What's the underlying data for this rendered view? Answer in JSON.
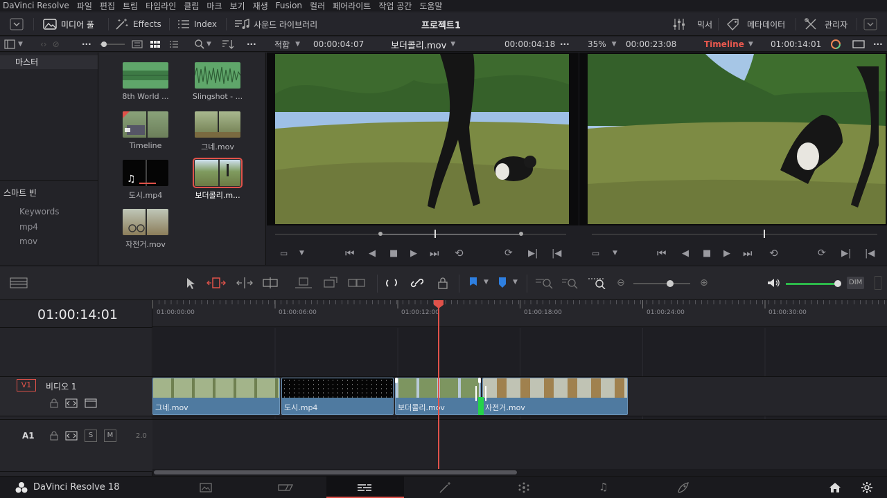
{
  "menu": [
    "DaVinci Resolve",
    "파일",
    "편집",
    "트림",
    "타임라인",
    "클립",
    "마크",
    "보기",
    "재생",
    "Fusion",
    "컬러",
    "페어라이트",
    "작업 공간",
    "도움말"
  ],
  "toolbar": {
    "media_pool": "미디어 풀",
    "effects": "Effects",
    "index": "Index",
    "sound_library": "사운드 라이브러리",
    "project_title": "프로젝트1",
    "mixer": "믹서",
    "metadata": "메타데이터",
    "inspector": "관리자"
  },
  "viewer_bar": {
    "fit": "적합",
    "source_duration": "00:00:04:07",
    "source_clip": "보더콜리.mov",
    "source_timecode": "00:00:04:18",
    "zoom": "35%",
    "timeline_duration": "00:00:23:08",
    "timeline_name": "Timeline",
    "timeline_timecode": "01:00:14:01"
  },
  "bins": {
    "master": "마스터",
    "smart_bins": "스마트 빈",
    "items": [
      "Keywords",
      "mp4",
      "mov"
    ]
  },
  "media_clips": [
    {
      "label": "8th World ...",
      "kind": "audio"
    },
    {
      "label": "Slingshot - ...",
      "kind": "audio"
    },
    {
      "label": "Timeline",
      "kind": "timeline"
    },
    {
      "label": "그네.mov",
      "kind": "video"
    },
    {
      "label": "도시.mp4",
      "kind": "music"
    },
    {
      "label": "보더콜리.m...",
      "kind": "video",
      "selected": true
    },
    {
      "label": "자전거.mov",
      "kind": "video"
    }
  ],
  "timeline": {
    "current_timecode": "01:00:14:01",
    "ruler": [
      "01:00:00:00",
      "01:00:06:00",
      "01:00:12:00",
      "01:00:18:00",
      "01:00:24:00",
      "01:00:30:00"
    ],
    "tracks": {
      "v1_label": "V1",
      "v1_name": "비디오 1",
      "a1_label": "A1",
      "a1_level": "2.0",
      "solo": "S",
      "mute": "M"
    },
    "clips": [
      "그네.mov",
      "도시.mp4",
      "보더콜리.mov",
      "자전거.mov"
    ]
  },
  "volume": {
    "dim": "DIM"
  },
  "footer": {
    "app_name": "DaVinci Resolve 18"
  }
}
